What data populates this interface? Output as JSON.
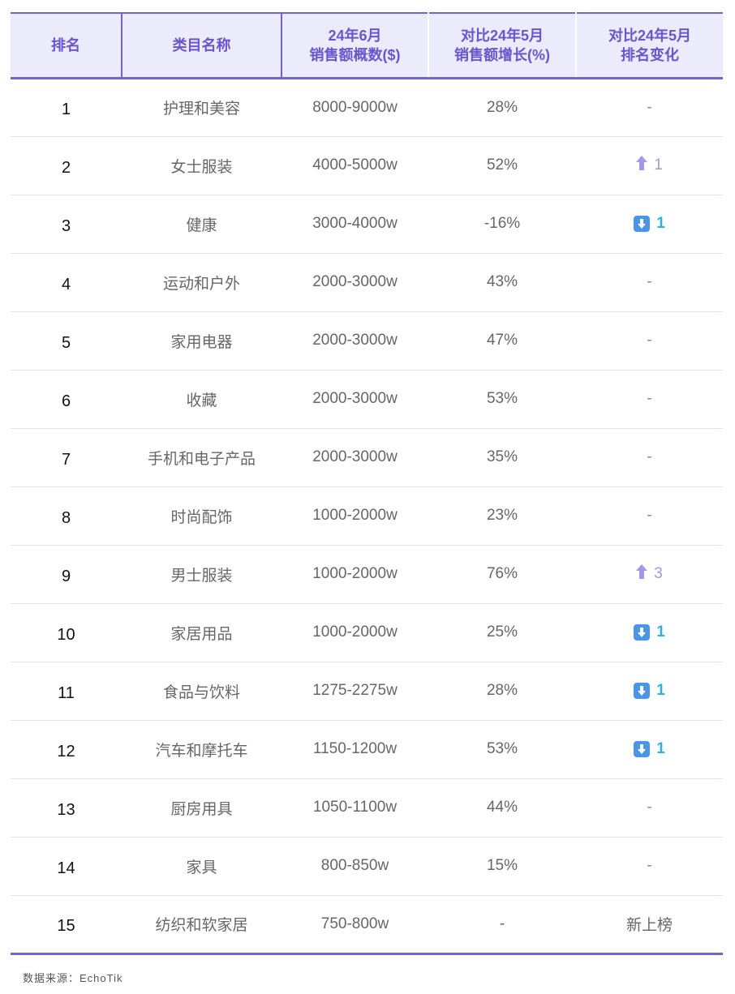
{
  "header": {
    "rank": "排名",
    "category": "类目名称",
    "sales_line1": "24年6月",
    "sales_line2": "销售额概数($)",
    "growth_line1": "对比24年5月",
    "growth_line2": "销售额增长(%)",
    "change_line1": "对比24年5月",
    "change_line2": "排名变化"
  },
  "rows": [
    {
      "rank": "1",
      "category": "护理和美容",
      "sales": "8000-9000w",
      "growth": "28%",
      "change": {
        "type": "none",
        "text": "-"
      }
    },
    {
      "rank": "2",
      "category": "女士服装",
      "sales": "4000-5000w",
      "growth": "52%",
      "change": {
        "type": "up",
        "value": "1"
      }
    },
    {
      "rank": "3",
      "category": "健康",
      "sales": "3000-4000w",
      "growth": "-16%",
      "change": {
        "type": "down",
        "value": "1"
      }
    },
    {
      "rank": "4",
      "category": "运动和户外",
      "sales": "2000-3000w",
      "growth": "43%",
      "change": {
        "type": "none",
        "text": "-"
      }
    },
    {
      "rank": "5",
      "category": "家用电器",
      "sales": "2000-3000w",
      "growth": "47%",
      "change": {
        "type": "none",
        "text": "-"
      }
    },
    {
      "rank": "6",
      "category": "收藏",
      "sales": "2000-3000w",
      "growth": "53%",
      "change": {
        "type": "none",
        "text": "-"
      }
    },
    {
      "rank": "7",
      "category": "手机和电子产品",
      "sales": "2000-3000w",
      "growth": "35%",
      "change": {
        "type": "none",
        "text": "-"
      }
    },
    {
      "rank": "8",
      "category": "时尚配饰",
      "sales": "1000-2000w",
      "growth": "23%",
      "change": {
        "type": "none",
        "text": "-"
      }
    },
    {
      "rank": "9",
      "category": "男士服装",
      "sales": "1000-2000w",
      "growth": "76%",
      "change": {
        "type": "up",
        "value": "3"
      }
    },
    {
      "rank": "10",
      "category": "家居用品",
      "sales": "1000-2000w",
      "growth": "25%",
      "change": {
        "type": "down",
        "value": "1"
      }
    },
    {
      "rank": "11",
      "category": "食品与饮料",
      "sales": "1275-2275w",
      "growth": "28%",
      "change": {
        "type": "down",
        "value": "1"
      }
    },
    {
      "rank": "12",
      "category": "汽车和摩托车",
      "sales": "1150-1200w",
      "growth": "53%",
      "change": {
        "type": "down",
        "value": "1"
      }
    },
    {
      "rank": "13",
      "category": "厨房用具",
      "sales": "1050-1100w",
      "growth": "44%",
      "change": {
        "type": "none-accent",
        "text": "-"
      }
    },
    {
      "rank": "14",
      "category": "家具",
      "sales": "800-850w",
      "growth": "15%",
      "change": {
        "type": "none",
        "text": "-"
      }
    },
    {
      "rank": "15",
      "category": "纺织和软家居",
      "sales": "750-800w",
      "growth": "-",
      "change": {
        "type": "new",
        "text": "新上榜"
      }
    }
  ],
  "source": "数据来源：EchoTik",
  "colors": {
    "accent": "#7462d2",
    "header_bg": "#ecebfb",
    "up": "#a397e6",
    "down_box": "#4a95ea",
    "down_num": "#29b4df"
  },
  "icons": {
    "up": "arrow-up-icon",
    "down": "arrow-down-box-icon"
  }
}
